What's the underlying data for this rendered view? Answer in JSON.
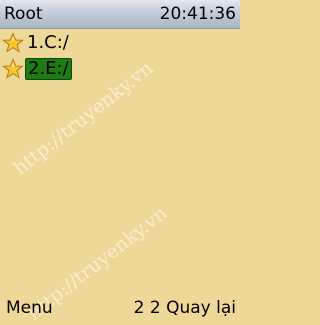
{
  "header": {
    "title": "Root",
    "time": "20:41:36"
  },
  "file_list": {
    "items": [
      {
        "label": "1.C:/",
        "icon": "star-folder-icon",
        "selected": false
      },
      {
        "label": "2.E:/",
        "icon": "star-folder-icon",
        "selected": true
      }
    ]
  },
  "watermark": {
    "text": "http://truyenky.vn"
  },
  "softkeys": {
    "left": "Menu",
    "right": "2 2 Quay lại"
  },
  "colors": {
    "background": "#eed898",
    "selection": "#1e7d12",
    "titlebar": "#c3cdd9"
  }
}
